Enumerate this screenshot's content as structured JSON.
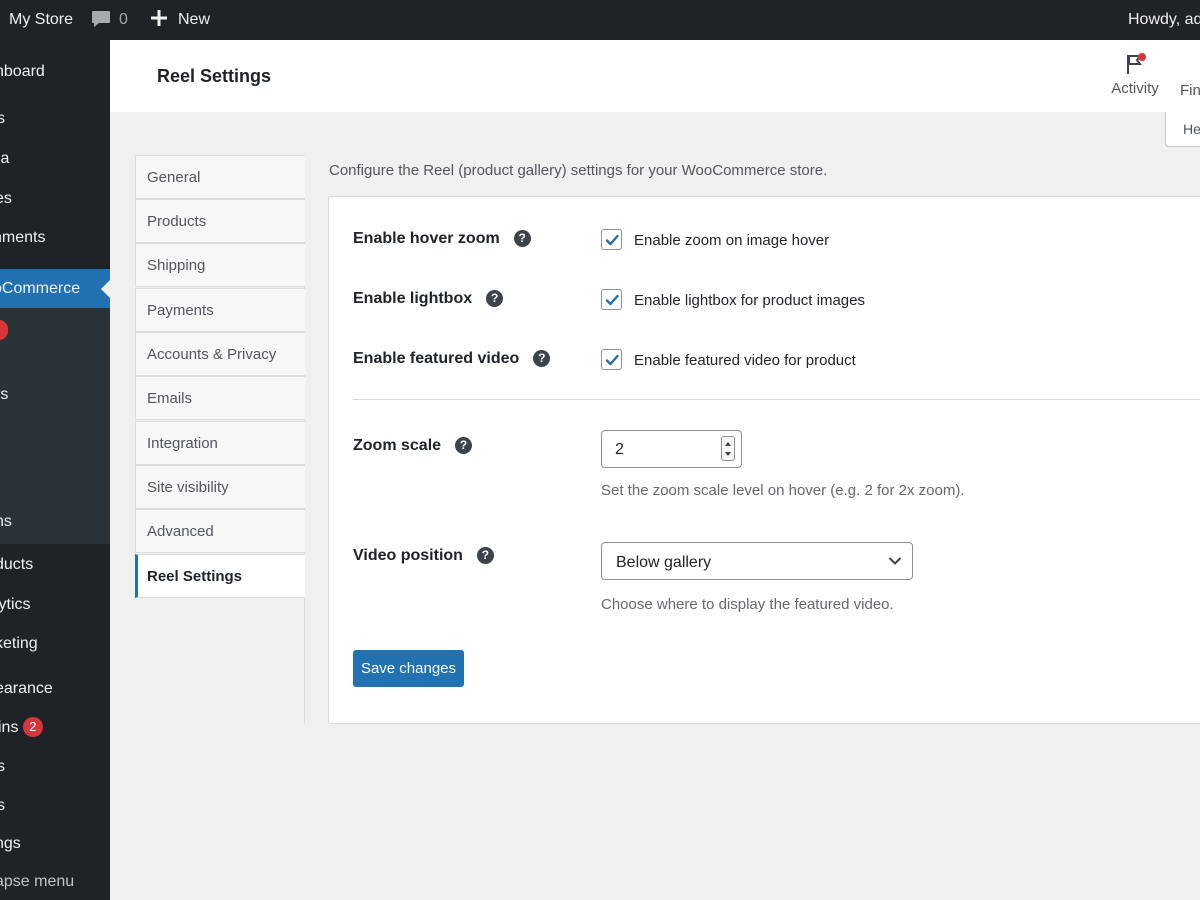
{
  "admin_bar": {
    "site_name": "My Store",
    "comments_count": "0",
    "new_label": "New",
    "howdy": "Howdy, ad"
  },
  "sidebar": {
    "items": [
      {
        "label": "hboard"
      },
      {
        "label": "s"
      },
      {
        "label": "ia"
      },
      {
        "label": "es"
      },
      {
        "label": "nments"
      },
      {
        "label": "oCommerce"
      },
      {
        "label": "rs"
      },
      {
        "label": "ns"
      },
      {
        "label": "ducts"
      },
      {
        "label": "lytics"
      },
      {
        "label": "keting"
      },
      {
        "label": "earance"
      },
      {
        "label": "ins",
        "badge": "2"
      },
      {
        "label": "s"
      },
      {
        "label": "s"
      },
      {
        "label": "ngs"
      },
      {
        "label": "apse menu"
      }
    ]
  },
  "header": {
    "title": "Reel Settings",
    "activity_label": "Activity",
    "finish_label": "Fin",
    "help_label": "He"
  },
  "tabs": [
    {
      "label": "General"
    },
    {
      "label": "Products"
    },
    {
      "label": "Shipping"
    },
    {
      "label": "Payments"
    },
    {
      "label": "Accounts & Privacy"
    },
    {
      "label": "Emails"
    },
    {
      "label": "Integration"
    },
    {
      "label": "Site visibility"
    },
    {
      "label": "Advanced"
    },
    {
      "label": "Reel Settings",
      "active": true
    }
  ],
  "intro": "Configure the Reel (product gallery) settings for your WooCommerce store.",
  "settings": {
    "hover_zoom": {
      "label": "Enable hover zoom",
      "checkbox_label": "Enable zoom on image hover",
      "checked": true
    },
    "lightbox": {
      "label": "Enable lightbox",
      "checkbox_label": "Enable lightbox for product images",
      "checked": true
    },
    "featured_video": {
      "label": "Enable featured video",
      "checkbox_label": "Enable featured video for product",
      "checked": true
    },
    "zoom_scale": {
      "label": "Zoom scale",
      "value": "2",
      "description": "Set the zoom scale level on hover (e.g. 2 for 2x zoom)."
    },
    "video_position": {
      "label": "Video position",
      "selected": "Below gallery",
      "description": "Choose where to display the featured video."
    }
  },
  "save_label": "Save changes",
  "colors": {
    "admin_bg": "#1d2327",
    "accent": "#2271b1",
    "badge": "#d63638",
    "page_bg": "#f0f0f1"
  },
  "icons": {
    "help": "question-circle-icon",
    "checkmark": "checkmark-icon",
    "flag": "flag-icon",
    "comment": "comment-bubble-icon",
    "plus": "plus-icon",
    "chevron": "chevron-down-icon"
  }
}
